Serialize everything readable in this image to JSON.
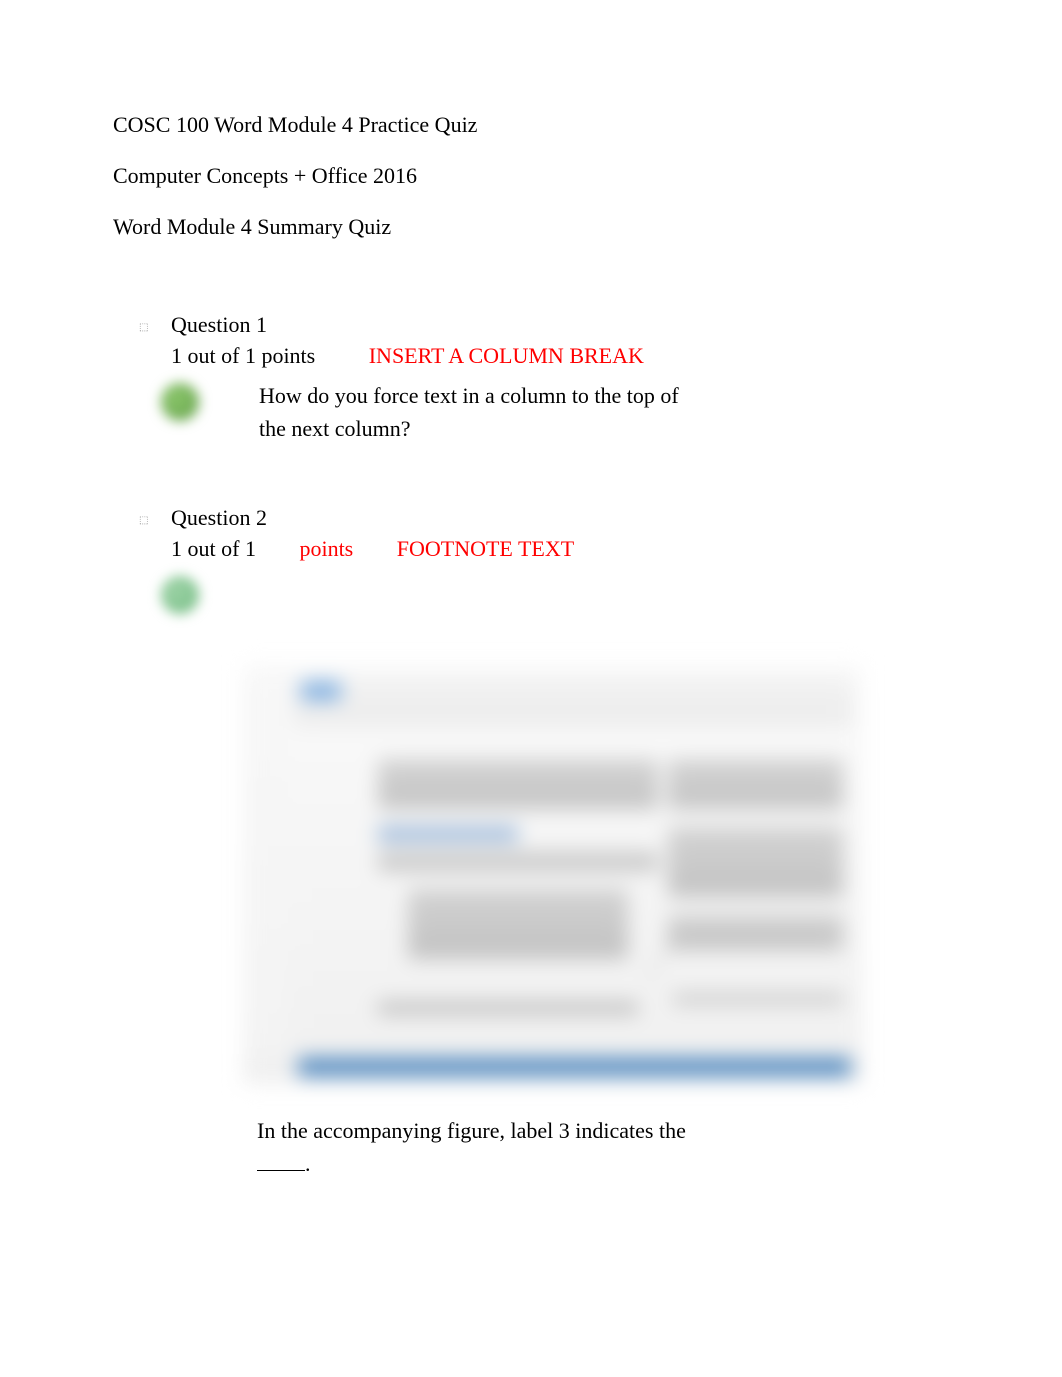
{
  "header": {
    "line1": "COSC 100 Word Module 4 Practice Quiz",
    "line2": "Computer Concepts + Office 2016",
    "line3": "Word Module 4 Summary Quiz"
  },
  "questions": [
    {
      "title": "Question 1",
      "points_prefix": "1 out of 1 points",
      "answer": "INSERT A COLUMN BREAK",
      "body": "How do you force text in a column to the top of the next column?"
    },
    {
      "title": "Question 2",
      "points_black": "1 out of 1",
      "points_red_word": "points",
      "answer": "FOOTNOTE TEXT",
      "caption": "In the accompanying figure, label 3 indicates the ____."
    }
  ]
}
